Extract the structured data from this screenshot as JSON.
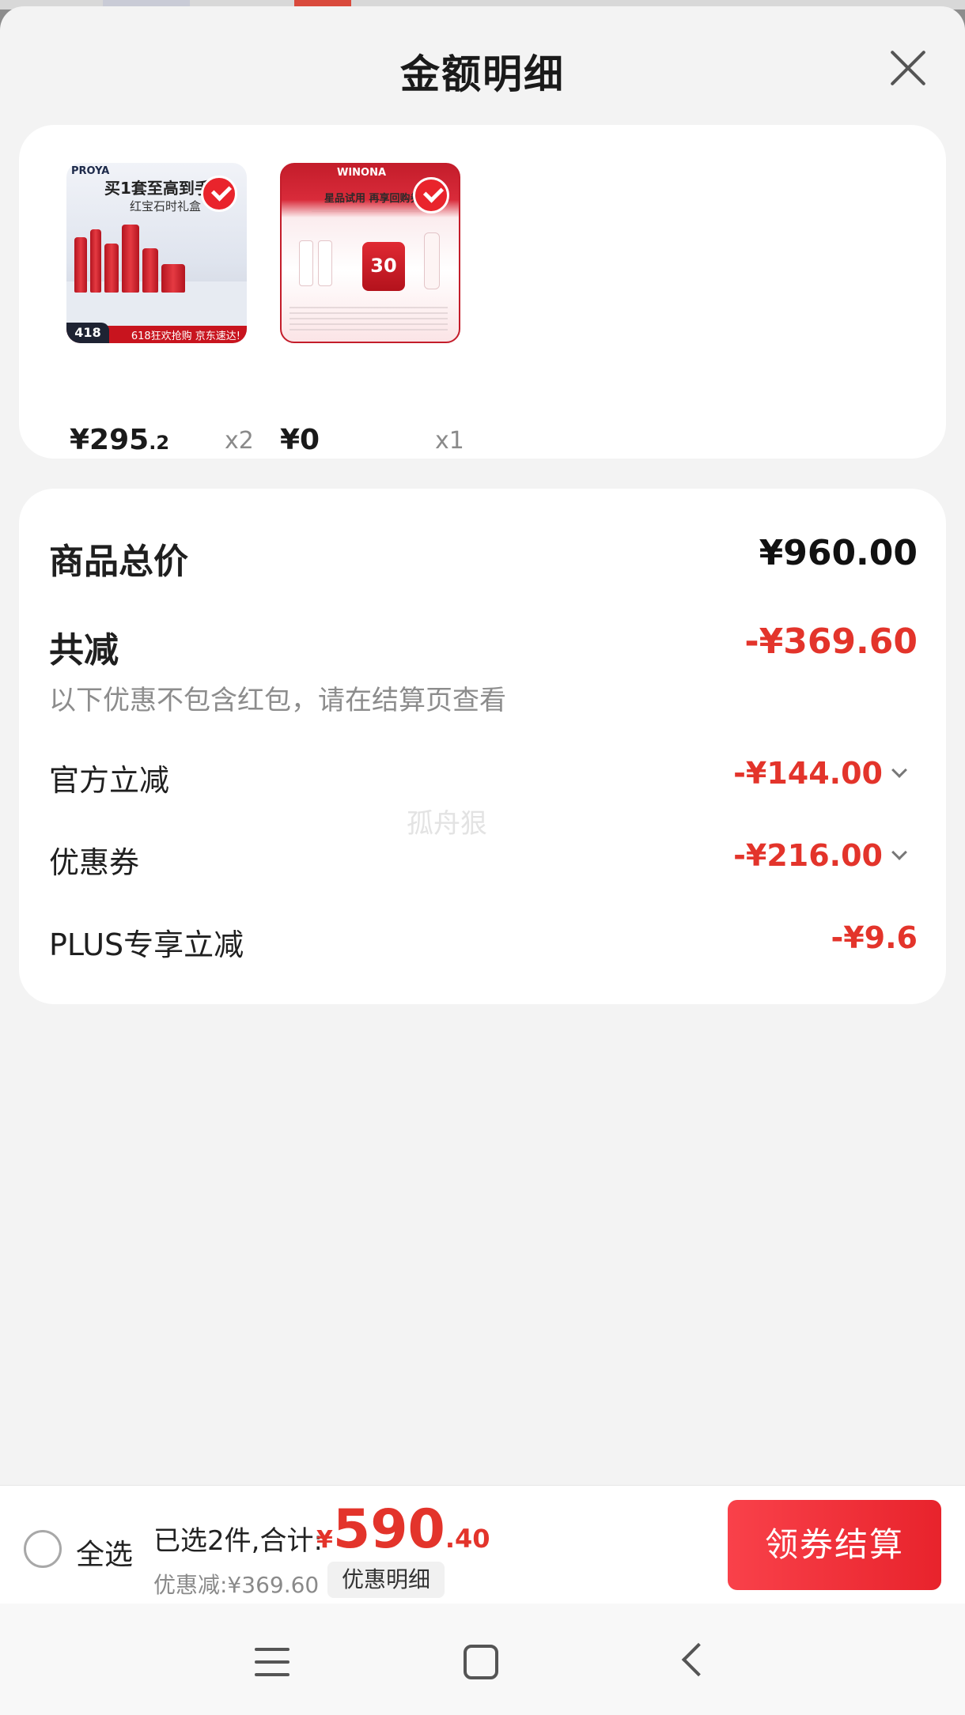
{
  "sheet": {
    "title": "金额明细"
  },
  "products": [
    {
      "thumb_brand": "PROYA",
      "thumb_promo": "买1套至高到手11",
      "thumb_promo_sub": "红宝石时礼盒",
      "thumb_badge": "418",
      "thumb_footer": "618狂欢抢购 京东速达!",
      "price_int": "¥295",
      "price_dec": ".2",
      "qty": "x2",
      "selected": true
    },
    {
      "thumb_brand": "WINONA",
      "thumb_title": "星品试用 再享回购券",
      "thumb_coupon": "30",
      "price_int": "¥0",
      "price_dec": "",
      "qty": "x1",
      "selected": true
    }
  ],
  "breakdown": {
    "total_label": "商品总价",
    "total_value": "¥960.00",
    "reduce_label": "共减",
    "reduce_value": "-¥369.60",
    "note": "以下优惠不包含红包，请在结算页查看",
    "items": [
      {
        "label": "官方立减",
        "value": "-¥144.00",
        "expandable": true
      },
      {
        "label": "优惠券",
        "value": "-¥216.00",
        "expandable": true
      },
      {
        "label": "PLUS专享立减",
        "value": "-¥9.6",
        "expandable": false
      }
    ],
    "watermark": "孤舟狠"
  },
  "bottom_bar": {
    "select_all": "全选",
    "summary": "已选2件,合计:",
    "total_yen": "¥",
    "total_int": "590",
    "total_dec": ".40",
    "saved": "优惠减:¥369.60",
    "detail_button": "优惠明细",
    "checkout_button": "领券结算"
  },
  "colors": {
    "accent": "#e3342b",
    "checkout": "#f9414a",
    "sheet_bg": "#f3f3f3"
  },
  "icons": {
    "close": "close-icon",
    "check": "checkmark-icon",
    "chevron": "chevron-down-icon",
    "nav": [
      "menu-icon",
      "home-icon",
      "back-icon"
    ]
  }
}
